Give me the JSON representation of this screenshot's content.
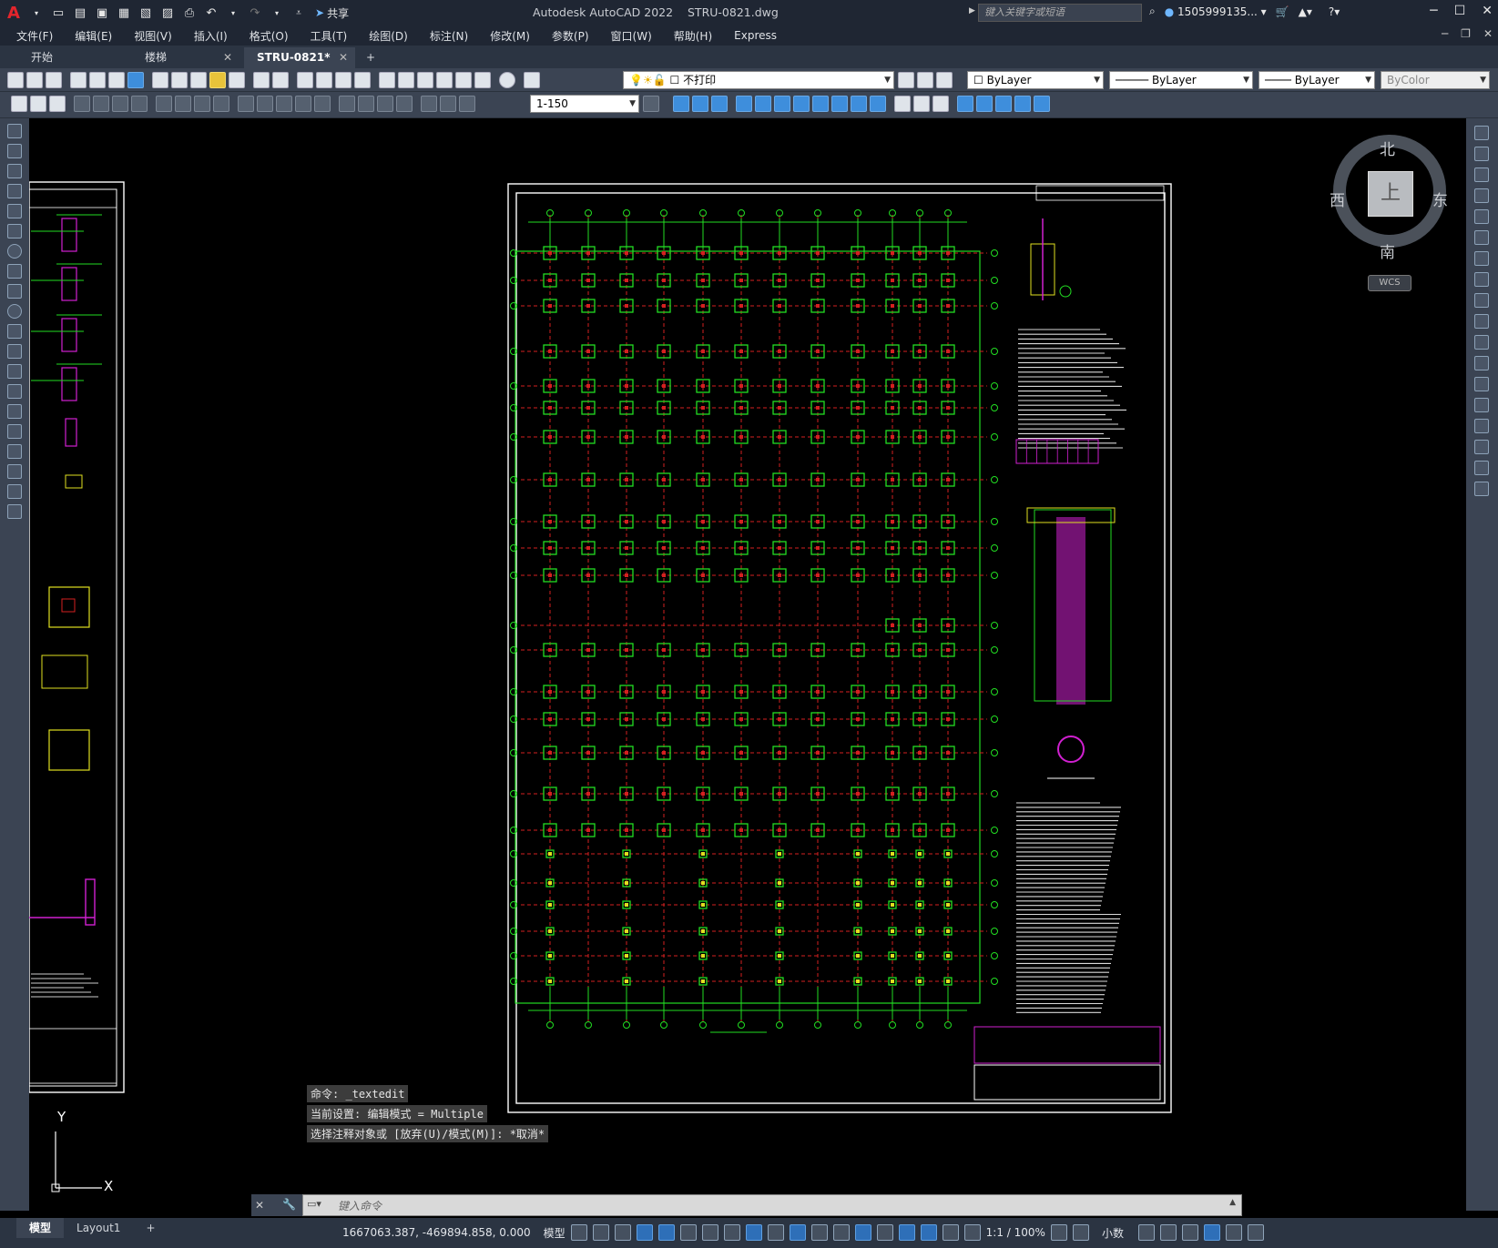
{
  "app": {
    "title": "Autodesk AutoCAD 2022",
    "filename": "STRU-0821.dwg",
    "share_label": "共享",
    "search_placeholder": "键入关键字或短语",
    "username": "1505999135..."
  },
  "menu": [
    "文件(F)",
    "编辑(E)",
    "视图(V)",
    "插入(I)",
    "格式(O)",
    "工具(T)",
    "绘图(D)",
    "标注(N)",
    "修改(M)",
    "参数(P)",
    "窗口(W)",
    "帮助(H)",
    "Express"
  ],
  "tabs": [
    {
      "label": "开始",
      "active": false
    },
    {
      "label": "楼梯",
      "active": false
    },
    {
      "label": "STRU-0821*",
      "active": true
    }
  ],
  "toolbar": {
    "layer_state": "不打印",
    "color": "ByLayer",
    "linetype": "ByLayer",
    "lineweight": "ByLayer",
    "plotstyle": "ByColor",
    "annotation_scale": "1-150"
  },
  "viewcube": {
    "face": "上",
    "north": "北",
    "south": "南",
    "east": "东",
    "west": "西",
    "wcs": "WCS"
  },
  "ucs": {
    "x": "X",
    "y": "Y"
  },
  "command_history": [
    "命令: _textedit",
    "当前设置: 编辑模式 = Multiple",
    "选择注释对象或 [放弃(U)/模式(M)]: *取消*"
  ],
  "command_placeholder": "键入命令",
  "layout_tabs": [
    {
      "label": "模型",
      "active": true
    },
    {
      "label": "Layout1",
      "active": false
    }
  ],
  "status": {
    "coordinates": "1667063.387, -469894.858, 0.000",
    "mode": "模型",
    "scale": "1:1 / 100%",
    "units": "小数"
  },
  "colors": {
    "grid_red": "#d42020",
    "grid_green": "#22dd22",
    "frame_white": "#ffffff",
    "magenta": "#d020d0",
    "yellow": "#e0e020",
    "cyan": "#20d0e0"
  }
}
